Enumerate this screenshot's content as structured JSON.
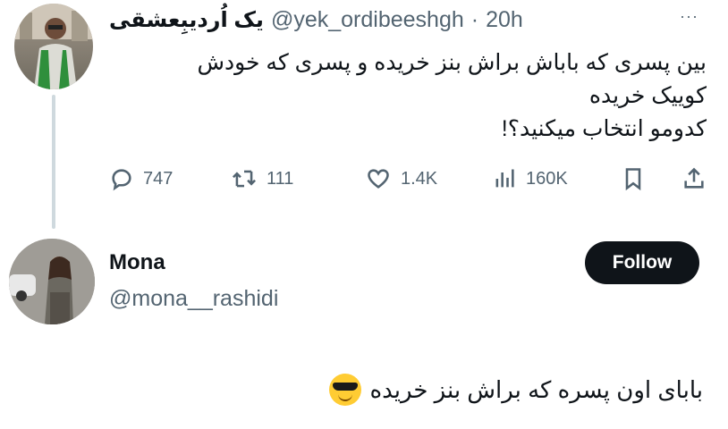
{
  "tweet": {
    "display_name": "یک اُردیبِعشقی",
    "handle": "@yek_ordibeeshgh",
    "separator": "·",
    "time": "20h",
    "more_label": "···",
    "lines": [
      "بین پسری که باباش براش بنز خریده و پسری که خودش",
      "کوییک خریده",
      "کدومو انتخاب میکنید؟!"
    ],
    "actions": {
      "replies": "747",
      "retweets": "111",
      "likes": "1.4K",
      "views": "160K"
    }
  },
  "reply": {
    "display_name": "Mona",
    "handle": "@mona__rashidi",
    "follow_label": "Follow",
    "text": "بابای اون پسره که براش بنز خریده",
    "emoji": "sunglasses-face"
  }
}
